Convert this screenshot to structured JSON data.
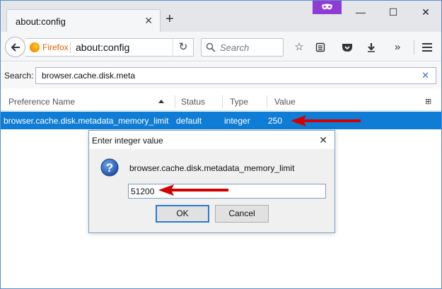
{
  "window": {
    "tab_title": "about:config",
    "tab_close": "✕",
    "new_tab": "+",
    "controls": {
      "minimize": "—",
      "maximize": "☐",
      "close": "✕"
    }
  },
  "navbar": {
    "identity_label": "Firefox",
    "url": "about:config",
    "search_placeholder": "Search"
  },
  "config": {
    "search_label": "Search:",
    "search_value": "browser.cache.disk.meta",
    "clear": "✕",
    "columns": {
      "name": "Preference Name",
      "status": "Status",
      "type": "Type",
      "value": "Value"
    },
    "selected_row": {
      "name": "browser.cache.disk.metadata_memory_limit",
      "status": "default",
      "type": "integer",
      "value": "250"
    }
  },
  "dialog": {
    "title": "Enter integer value",
    "close": "✕",
    "message": "browser.cache.disk.metadata_memory_limit",
    "input_value": "51200",
    "ok_label": "OK",
    "cancel_label": "Cancel"
  },
  "colors": {
    "selection": "#0f7dd6",
    "private_mask": "#8f3cd6",
    "annotation_arrow": "#d40000",
    "firefox_orange": "#e66000"
  },
  "icons": [
    "back-arrow-icon",
    "firefox-logo-icon",
    "reload-icon",
    "search-icon",
    "bookmark-star-icon",
    "reader-list-icon",
    "pocket-icon",
    "download-icon",
    "overflow-chevrons-icon",
    "hamburger-menu-icon",
    "private-mask-icon",
    "question-icon",
    "column-picker-icon"
  ]
}
